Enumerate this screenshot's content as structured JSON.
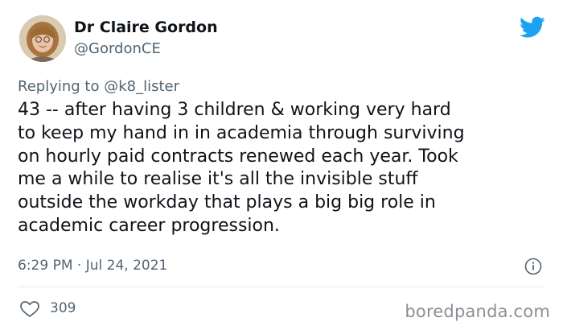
{
  "author": {
    "name": "Dr Claire Gordon",
    "handle": "@GordonCE"
  },
  "reply": {
    "prefix": "Replying to ",
    "mention": "@k8_lister"
  },
  "tweet": {
    "text": "43 -- after having 3 children & working very hard\nto keep my hand in in academia through surviving\non hourly paid contracts renewed each year. Took\nme a while to realise it's all the invisible stuff\noutside the workday that plays a big big role in\nacademic career progression.",
    "timestamp": "6:29 PM · Jul 24, 2021"
  },
  "engagement": {
    "likes": "309"
  },
  "watermark": "boredpanda.com",
  "icons": {
    "brand": "twitter-bird-icon",
    "info": "info-icon",
    "like": "heart-icon"
  },
  "colors": {
    "twitter_blue": "#1da1f2",
    "text_primary": "#0f1419",
    "text_secondary": "#536471",
    "divider": "#e1e8ed"
  }
}
